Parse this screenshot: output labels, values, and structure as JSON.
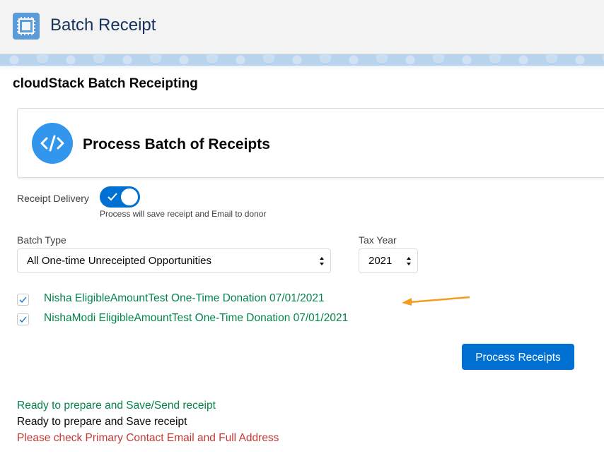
{
  "header": {
    "app_title": "Batch Receipt",
    "icon": "app-tile-icon"
  },
  "page": {
    "title": "cloudStack Batch Receipting"
  },
  "card": {
    "title": "Process Batch of Receipts",
    "icon": "code-icon"
  },
  "receipt_delivery": {
    "label": "Receipt Delivery",
    "enabled": true,
    "help_text": "Process will save receipt and Email to donor"
  },
  "batch_type": {
    "label": "Batch Type",
    "value": "All One-time Unreceipted Opportunities"
  },
  "tax_year": {
    "label": "Tax Year",
    "value": "2021"
  },
  "opportunities": [
    {
      "label": "Nisha EligibleAmountTest One-Time Donation 07/01/2021",
      "checked": true
    },
    {
      "label": "NishaModi EligibleAmountTest One-Time Donation 07/01/2021",
      "checked": true
    }
  ],
  "actions": {
    "process_label": "Process Receipts"
  },
  "status_messages": [
    {
      "text": "Ready to prepare and Save/Send receipt",
      "color": "#04844b"
    },
    {
      "text": "Ready to prepare and Save receipt",
      "color": "#080707"
    },
    {
      "text": "Please check Primary Contact Email and Full Address",
      "color": "#c23934"
    }
  ],
  "colors": {
    "brand": "#0070d2",
    "success": "#04844b",
    "error": "#c23934",
    "annotation_arrow": "#f39c1f"
  }
}
